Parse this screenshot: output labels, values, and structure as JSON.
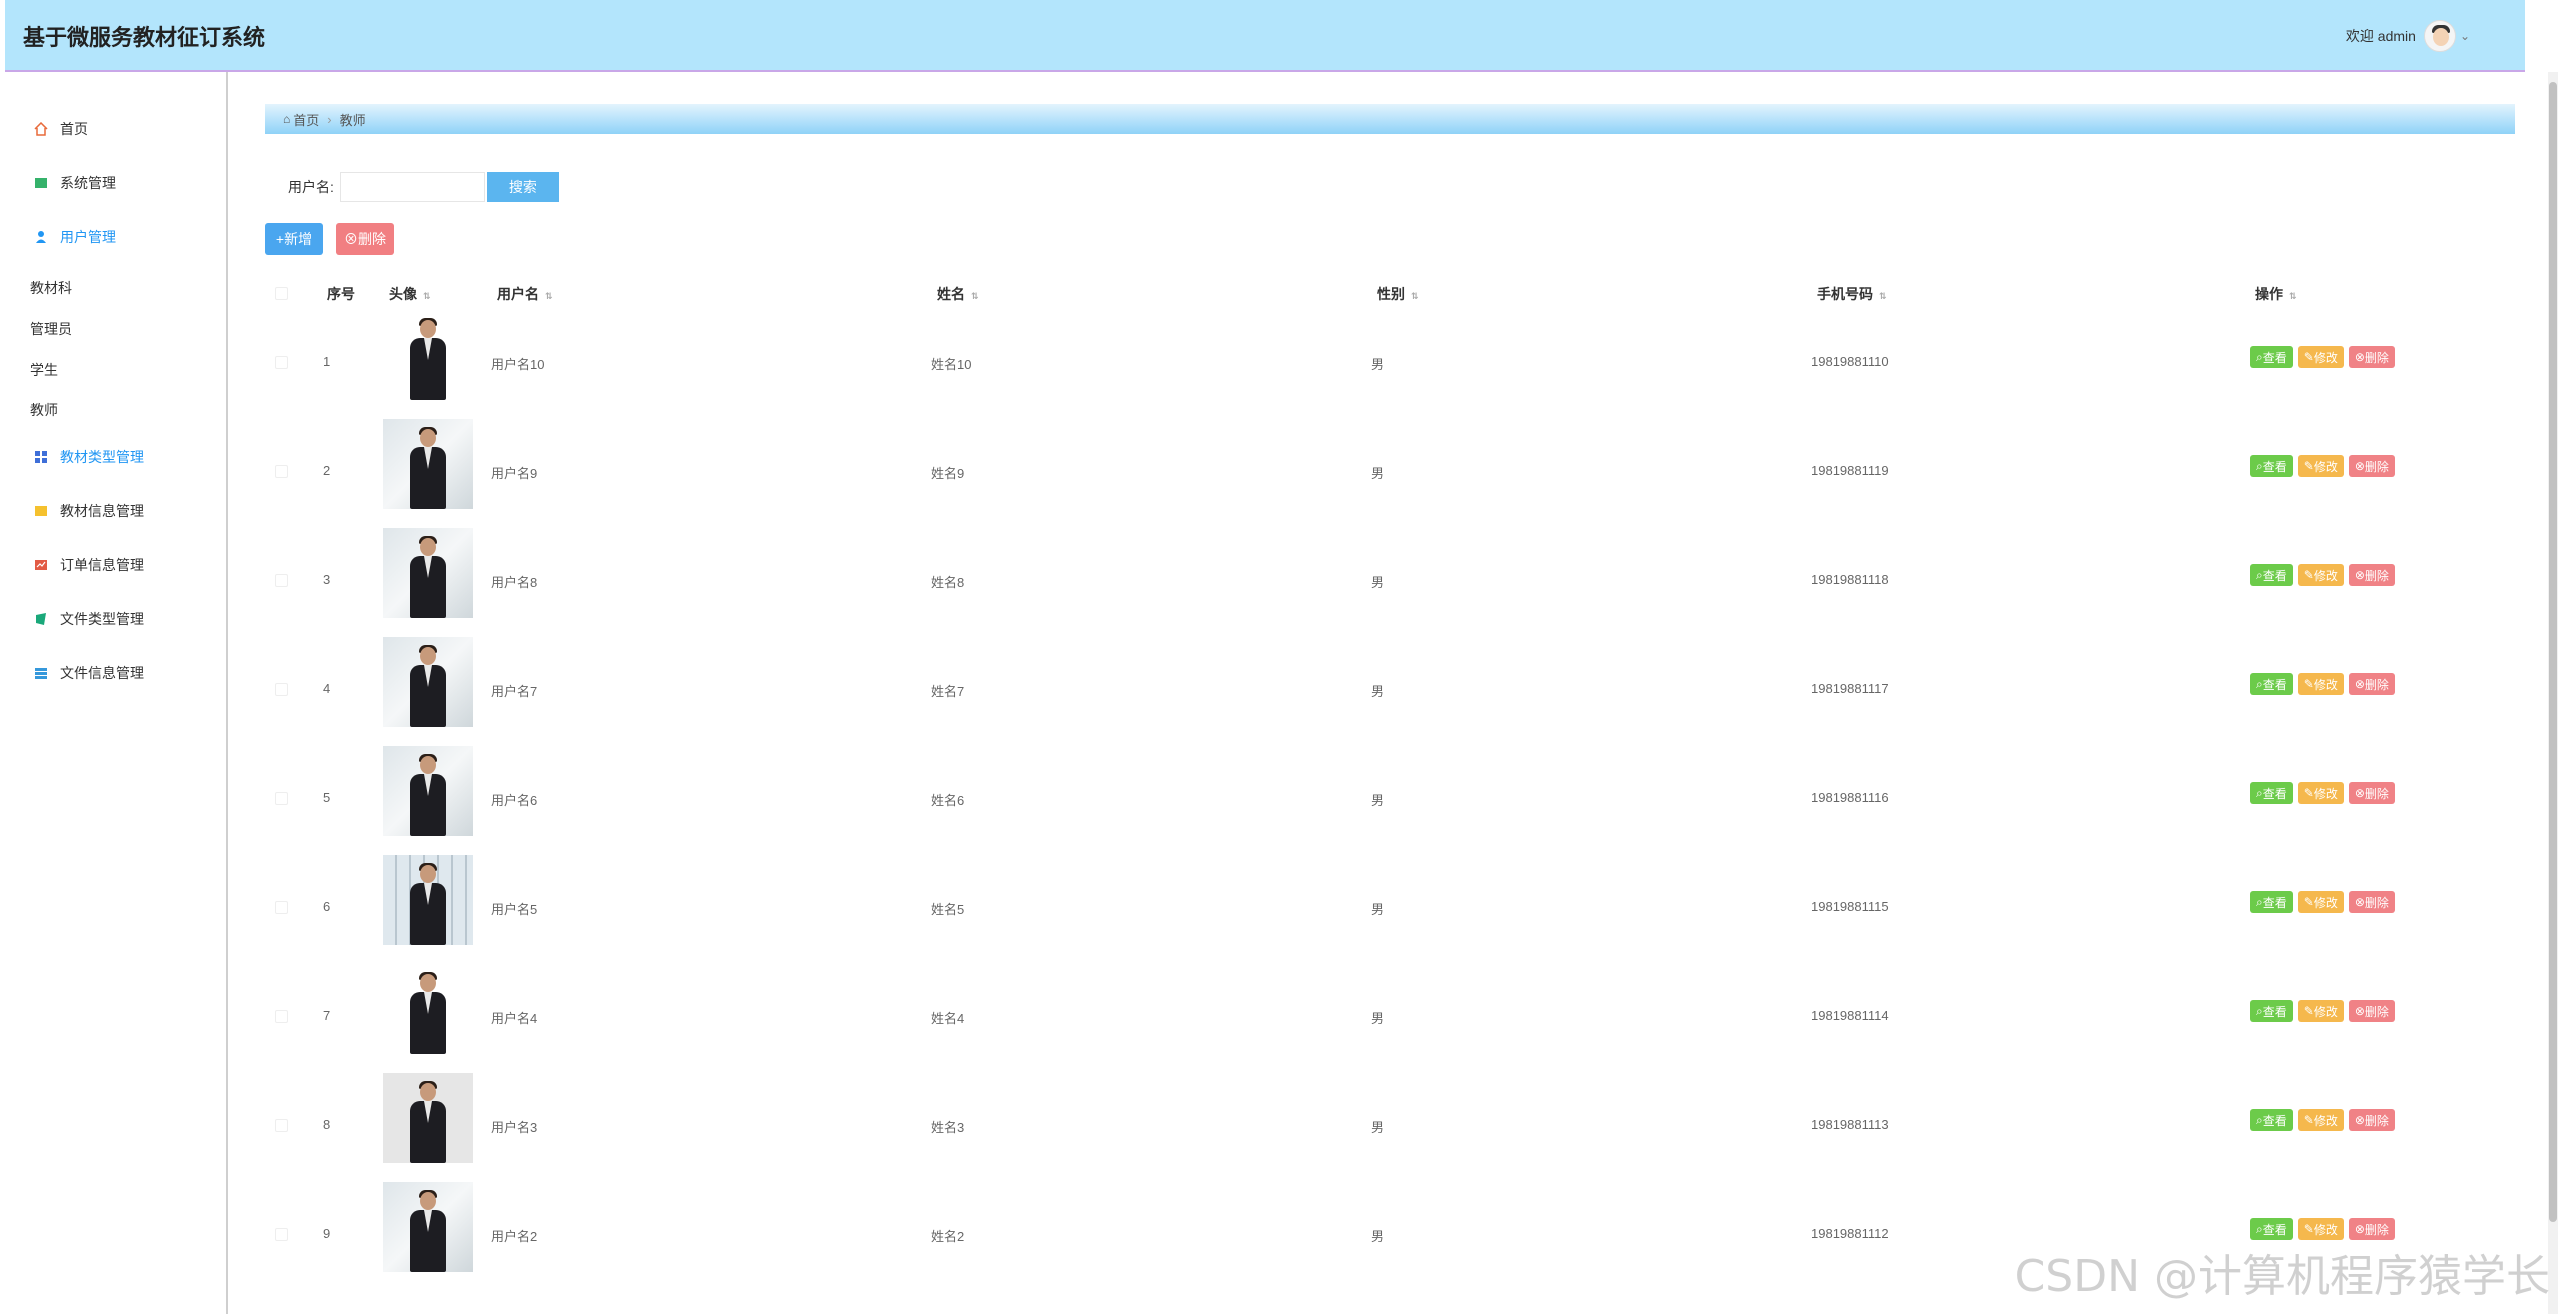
{
  "header": {
    "title": "基于微服务教材征订系统",
    "welcome": "欢迎 admin"
  },
  "sidebar": {
    "items": [
      {
        "label": "首页",
        "icon": "home-icon",
        "color": "#e86a3a"
      },
      {
        "label": "系统管理",
        "icon": "system-icon",
        "color": "#35b26b"
      },
      {
        "label": "用户管理",
        "icon": "user-icon",
        "color": "#2196f3"
      },
      {
        "label": "教材类型管理",
        "icon": "grid-icon",
        "color": "#3f6fd8"
      },
      {
        "label": "教材信息管理",
        "icon": "book-icon",
        "color": "#f5c12e"
      },
      {
        "label": "订单信息管理",
        "icon": "order-icon",
        "color": "#e25b45"
      },
      {
        "label": "文件类型管理",
        "icon": "file-type-icon",
        "color": "#1aa87a"
      },
      {
        "label": "文件信息管理",
        "icon": "file-info-icon",
        "color": "#3598db"
      }
    ],
    "subitems": [
      "教材科",
      "管理员",
      "学生",
      "教师"
    ]
  },
  "breadcrumb": {
    "home": "首页",
    "current": "教师"
  },
  "search": {
    "label": "用户名:",
    "button": "搜索",
    "value": ""
  },
  "actions": {
    "add": "+新增",
    "delete": "⊗删除"
  },
  "table": {
    "headers": {
      "index": "序号",
      "avatar": "头像",
      "username": "用户名",
      "name": "姓名",
      "gender": "性别",
      "phone": "手机号码",
      "ops": "操作"
    },
    "op_labels": {
      "view": "查看",
      "edit": "修改",
      "delete": "删除"
    },
    "rows": [
      {
        "index": "1",
        "username": "用户名10",
        "name": "姓名10",
        "gender": "男",
        "phone": "19819881110",
        "bg": "white"
      },
      {
        "index": "2",
        "username": "用户名9",
        "name": "姓名9",
        "gender": "男",
        "phone": "19819881119",
        "bg": "office"
      },
      {
        "index": "3",
        "username": "用户名8",
        "name": "姓名8",
        "gender": "男",
        "phone": "19819881118",
        "bg": "office"
      },
      {
        "index": "4",
        "username": "用户名7",
        "name": "姓名7",
        "gender": "男",
        "phone": "19819881117",
        "bg": "office"
      },
      {
        "index": "5",
        "username": "用户名6",
        "name": "姓名6",
        "gender": "男",
        "phone": "19819881116",
        "bg": "office"
      },
      {
        "index": "6",
        "username": "用户名5",
        "name": "姓名5",
        "gender": "男",
        "phone": "19819881115",
        "bg": "window"
      },
      {
        "index": "7",
        "username": "用户名4",
        "name": "姓名4",
        "gender": "男",
        "phone": "19819881114",
        "bg": "white"
      },
      {
        "index": "8",
        "username": "用户名3",
        "name": "姓名3",
        "gender": "男",
        "phone": "19819881113",
        "bg": "grey"
      },
      {
        "index": "9",
        "username": "用户名2",
        "name": "姓名2",
        "gender": "男",
        "phone": "19819881112",
        "bg": "office"
      }
    ]
  },
  "watermark": "CSDN @计算机程序猿学长"
}
